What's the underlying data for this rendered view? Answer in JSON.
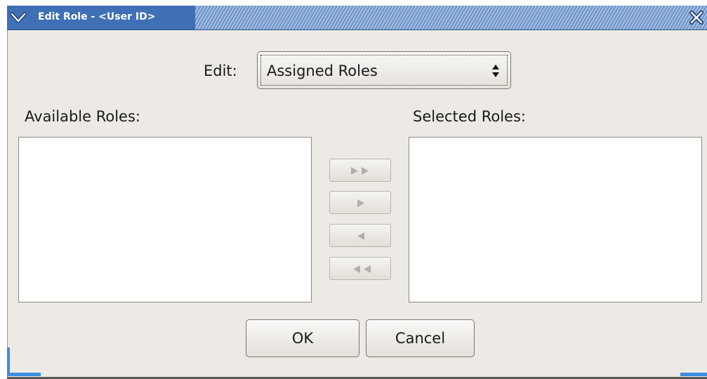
{
  "window": {
    "title": "Edit Role - <User ID>"
  },
  "edit": {
    "label": "Edit:",
    "selected": "Assigned Roles"
  },
  "available": {
    "label": "Available Roles:",
    "items": []
  },
  "selected_roles": {
    "label": "Selected Roles:",
    "items": []
  },
  "transfer_buttons": {
    "add_all_icon": "double-right-arrow-icon",
    "add_icon": "right-arrow-icon",
    "remove_icon": "left-arrow-icon",
    "remove_all_icon": "double-left-arrow-icon"
  },
  "buttons": {
    "ok": "OK",
    "cancel": "Cancel"
  },
  "colors": {
    "titlebar": "#3f6fb5",
    "dialog_bg": "#edeae6",
    "accent": "#3a8de0"
  }
}
